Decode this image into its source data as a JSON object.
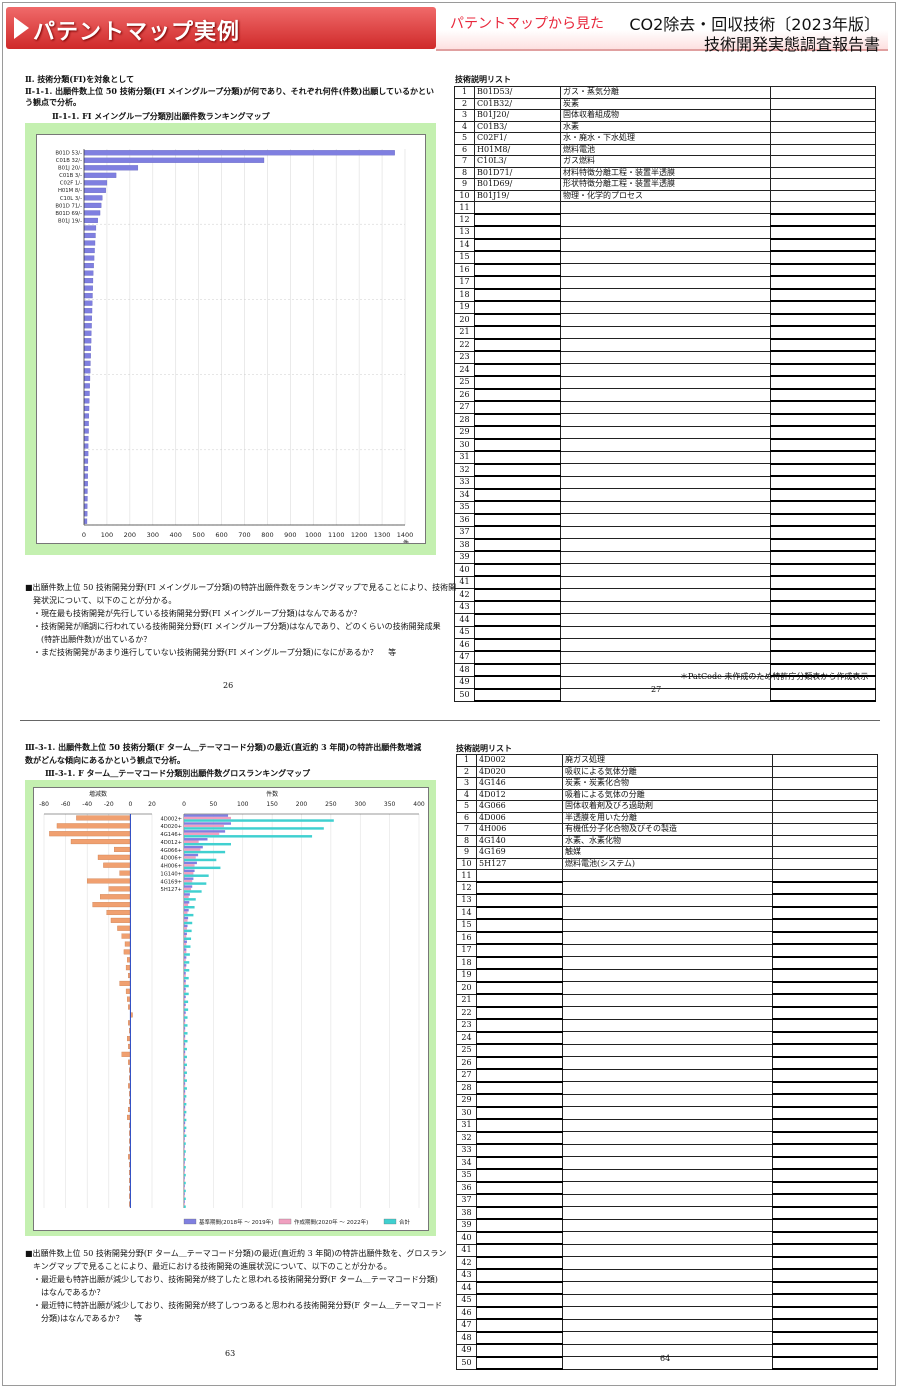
{
  "header": {
    "title": "パテントマップ実例",
    "subtitle": "パテントマップから見た",
    "report_line1": "CO2除去・回収技術〔2023年版〕",
    "report_line2": "技術開発実態調査報告書"
  },
  "sec1": {
    "heading": "Ⅱ. 技術分類(FI)を対象として",
    "sub_heading_1": "Ⅱ-1-1. 出願件数上位 50 技術分類(FI メイングループ分類)が何であり、それぞれ何件(件数)出願しているかとい",
    "sub_heading_2": "う観点で分析。",
    "chart_title": "Ⅱ-1-1. FI メイングループ分類別出願件数ランキングマップ",
    "desc": [
      "■出願件数上位 50 技術開発分野(FI メイングループ分類)の特許出願件数をランキングマップで見ることにより、技術開",
      "　発状況について、以下のことが分かる。",
      "　・現在最も技術開発が先行している技術開発分野(FI メイングループ分類)はなんであるか？",
      "　・技術開発が順調に行われている技術開発分野(FI メイングループ分類)はなんであり、どのくらいの技術開発成果",
      "　　(特許出願件数)が出ているか？",
      "　・まだ技術開発があまり進行していない技術開発分野(FI メイングループ分類)になにがあるか？　 等"
    ],
    "page_left": "26",
    "page_right": "27",
    "list_title": "技術説明リスト",
    "list_rows": [
      {
        "no": "1",
        "code": "B01D53/",
        "desc": "ガス・蒸気分離"
      },
      {
        "no": "2",
        "code": "C01B32/",
        "desc": "炭素"
      },
      {
        "no": "3",
        "code": "B01J20/",
        "desc": "固体収着組成物"
      },
      {
        "no": "4",
        "code": "C01B3/",
        "desc": "水素"
      },
      {
        "no": "5",
        "code": "C02F1/",
        "desc": "水・廃水・下水処理"
      },
      {
        "no": "6",
        "code": "H01M8/",
        "desc": "燃料電池"
      },
      {
        "no": "7",
        "code": "C10L3/",
        "desc": "ガス燃料"
      },
      {
        "no": "8",
        "code": "B01D71/",
        "desc": "材料特徴分離工程・装置半透膜"
      },
      {
        "no": "9",
        "code": "B01D69/",
        "desc": "形状特徴分離工程・装置半透膜"
      },
      {
        "no": "10",
        "code": "B01J19/",
        "desc": "物理・化学的プロセス"
      },
      {
        "no": "11",
        "code": "",
        "desc": ""
      },
      {
        "no": "12",
        "code": "",
        "desc": ""
      },
      {
        "no": "13",
        "code": "",
        "desc": ""
      },
      {
        "no": "14",
        "code": "",
        "desc": ""
      },
      {
        "no": "15",
        "code": "",
        "desc": ""
      },
      {
        "no": "16",
        "code": "",
        "desc": ""
      },
      {
        "no": "17",
        "code": "",
        "desc": ""
      },
      {
        "no": "18",
        "code": "",
        "desc": ""
      },
      {
        "no": "19",
        "code": "",
        "desc": ""
      },
      {
        "no": "20",
        "code": "",
        "desc": ""
      },
      {
        "no": "21",
        "code": "",
        "desc": ""
      },
      {
        "no": "22",
        "code": "",
        "desc": ""
      },
      {
        "no": "23",
        "code": "",
        "desc": ""
      },
      {
        "no": "24",
        "code": "",
        "desc": ""
      },
      {
        "no": "25",
        "code": "",
        "desc": ""
      },
      {
        "no": "26",
        "code": "",
        "desc": ""
      },
      {
        "no": "27",
        "code": "",
        "desc": ""
      },
      {
        "no": "28",
        "code": "",
        "desc": ""
      },
      {
        "no": "29",
        "code": "",
        "desc": ""
      },
      {
        "no": "30",
        "code": "",
        "desc": ""
      },
      {
        "no": "31",
        "code": "",
        "desc": ""
      },
      {
        "no": "32",
        "code": "",
        "desc": ""
      },
      {
        "no": "33",
        "code": "",
        "desc": ""
      },
      {
        "no": "34",
        "code": "",
        "desc": ""
      },
      {
        "no": "35",
        "code": "",
        "desc": ""
      },
      {
        "no": "36",
        "code": "",
        "desc": ""
      },
      {
        "no": "37",
        "code": "",
        "desc": ""
      },
      {
        "no": "38",
        "code": "",
        "desc": ""
      },
      {
        "no": "39",
        "code": "",
        "desc": ""
      },
      {
        "no": "40",
        "code": "",
        "desc": ""
      },
      {
        "no": "41",
        "code": "",
        "desc": ""
      },
      {
        "no": "42",
        "code": "",
        "desc": ""
      },
      {
        "no": "43",
        "code": "",
        "desc": ""
      },
      {
        "no": "44",
        "code": "",
        "desc": ""
      },
      {
        "no": "45",
        "code": "",
        "desc": ""
      },
      {
        "no": "46",
        "code": "",
        "desc": ""
      },
      {
        "no": "47",
        "code": "",
        "desc": ""
      },
      {
        "no": "48",
        "code": "",
        "desc": ""
      },
      {
        "no": "49",
        "code": "",
        "desc": ""
      },
      {
        "no": "50",
        "code": "",
        "desc": ""
      }
    ],
    "list_note": "＊PatCode 未作成のため特許庁分類表から作成表示"
  },
  "sec2": {
    "heading_1": "Ⅲ-3-1. 出願件数上位 50 技術分類(F ターム＿テーマコード分類)の最近(直近約 3 年間)の特許出願件数増減",
    "heading_2": "数がどんな傾向にあるかという観点で分析。",
    "chart_title": "Ⅲ-3-1. F ターム＿テーマコード分類別出願件数グロスランキングマップ",
    "desc": [
      "■出願件数上位 50 技術開発分野(F ターム＿テーマコード分類)の最近(直近約 3 年間)の特許出願件数を、グロスラン",
      "　キングマップで見ることにより、最近における技術開発の進展状況について、以下のことが分かる。",
      "　・最近最も特許出願が減少しており、技術開発が終了したと思われる技術開発分野(F ターム＿テーマコード分類)",
      "　　はなんであるか？",
      "　・最近特に特許出願が減少しており、技術開発が終了しつつあると思われる技術開発分野(F ターム＿テーマコード",
      "　　分類)はなんであるか？　 等"
    ],
    "page_left": "63",
    "page_right": "64",
    "list_title": "技術説明リスト",
    "list_rows": [
      {
        "no": "1",
        "code": "4D002",
        "desc": "廃ガス処理"
      },
      {
        "no": "2",
        "code": "4D020",
        "desc": "吸収による気体分離"
      },
      {
        "no": "3",
        "code": "4G146",
        "desc": "炭素・炭素化合物"
      },
      {
        "no": "4",
        "code": "4D012",
        "desc": "吸着による気体の分離"
      },
      {
        "no": "5",
        "code": "4G066",
        "desc": "固体収着剤及びろ過助剤"
      },
      {
        "no": "6",
        "code": "4D006",
        "desc": "半透膜を用いた分離"
      },
      {
        "no": "7",
        "code": "4H006",
        "desc": "有機低分子化合物及びその製造"
      },
      {
        "no": "8",
        "code": "4G140",
        "desc": "水素、水素化物"
      },
      {
        "no": "9",
        "code": "4G169",
        "desc": "触媒"
      },
      {
        "no": "10",
        "code": "5H127",
        "desc": "燃料電池(システム)"
      },
      {
        "no": "11",
        "code": "",
        "desc": ""
      },
      {
        "no": "12",
        "code": "",
        "desc": ""
      },
      {
        "no": "13",
        "code": "",
        "desc": ""
      },
      {
        "no": "14",
        "code": "",
        "desc": ""
      },
      {
        "no": "15",
        "code": "",
        "desc": ""
      },
      {
        "no": "16",
        "code": "",
        "desc": ""
      },
      {
        "no": "17",
        "code": "",
        "desc": ""
      },
      {
        "no": "18",
        "code": "",
        "desc": ""
      },
      {
        "no": "19",
        "code": "",
        "desc": ""
      },
      {
        "no": "20",
        "code": "",
        "desc": ""
      },
      {
        "no": "21",
        "code": "",
        "desc": ""
      },
      {
        "no": "22",
        "code": "",
        "desc": ""
      },
      {
        "no": "23",
        "code": "",
        "desc": ""
      },
      {
        "no": "24",
        "code": "",
        "desc": ""
      },
      {
        "no": "25",
        "code": "",
        "desc": ""
      },
      {
        "no": "26",
        "code": "",
        "desc": ""
      },
      {
        "no": "27",
        "code": "",
        "desc": ""
      },
      {
        "no": "28",
        "code": "",
        "desc": ""
      },
      {
        "no": "29",
        "code": "",
        "desc": ""
      },
      {
        "no": "30",
        "code": "",
        "desc": ""
      },
      {
        "no": "31",
        "code": "",
        "desc": ""
      },
      {
        "no": "32",
        "code": "",
        "desc": ""
      },
      {
        "no": "33",
        "code": "",
        "desc": ""
      },
      {
        "no": "34",
        "code": "",
        "desc": ""
      },
      {
        "no": "35",
        "code": "",
        "desc": ""
      },
      {
        "no": "36",
        "code": "",
        "desc": ""
      },
      {
        "no": "37",
        "code": "",
        "desc": ""
      },
      {
        "no": "38",
        "code": "",
        "desc": ""
      },
      {
        "no": "39",
        "code": "",
        "desc": ""
      },
      {
        "no": "40",
        "code": "",
        "desc": ""
      },
      {
        "no": "41",
        "code": "",
        "desc": ""
      },
      {
        "no": "42",
        "code": "",
        "desc": ""
      },
      {
        "no": "43",
        "code": "",
        "desc": ""
      },
      {
        "no": "44",
        "code": "",
        "desc": ""
      },
      {
        "no": "45",
        "code": "",
        "desc": ""
      },
      {
        "no": "46",
        "code": "",
        "desc": ""
      },
      {
        "no": "47",
        "code": "",
        "desc": ""
      },
      {
        "no": "48",
        "code": "",
        "desc": ""
      },
      {
        "no": "49",
        "code": "",
        "desc": ""
      },
      {
        "no": "50",
        "code": "",
        "desc": ""
      }
    ]
  },
  "chart_data": [
    {
      "type": "bar",
      "orientation": "horizontal",
      "categories": [
        "B01D 53/-",
        "C01B 32/-",
        "B01J 20/-",
        "C01B 3/-",
        "C02F 1/-",
        "H01M 8/-",
        "C10L 3/-",
        "B01D 71/-",
        "B01D 69/-",
        "B01J 19/-"
      ],
      "values": [
        1355,
        785,
        235,
        140,
        100,
        95,
        80,
        75,
        70,
        60,
        52,
        50,
        48,
        46,
        44,
        42,
        40,
        39,
        38,
        37,
        36,
        35,
        34,
        33,
        32,
        31,
        30,
        29,
        28,
        27,
        26,
        25,
        24,
        23,
        22,
        21,
        20,
        20,
        19,
        18,
        18,
        17,
        17,
        16,
        16,
        15,
        15,
        14,
        14,
        13
      ],
      "xlim": [
        0,
        1400
      ],
      "xticks": [
        "0",
        "100",
        "200",
        "300",
        "400",
        "500",
        "600",
        "700",
        "800",
        "900",
        "1000",
        "1100",
        "1200",
        "1300",
        "1400"
      ],
      "unit": "件",
      "bar_color": "#7f7fe0",
      "grid": true
    },
    {
      "type": "bar",
      "orientation": "horizontal",
      "subtype": "diverging",
      "title": "増減数",
      "xlim": [
        -80,
        20
      ],
      "xticks": [
        "-80",
        "-60",
        "-40",
        "-20",
        "0",
        "20"
      ],
      "values": [
        -50,
        -68,
        -75,
        -55,
        -15,
        -30,
        -25,
        -10,
        -40,
        -20,
        -28,
        -35,
        -22,
        -18,
        -12,
        -8,
        -5,
        -6,
        -3,
        -4,
        -2,
        -10,
        -4,
        -3,
        -2,
        2,
        -2,
        -1,
        -3,
        -2,
        -8,
        -2,
        -1,
        -1,
        -2,
        -1,
        -1,
        -2,
        -3,
        -1,
        -1,
        -1,
        -1,
        -2,
        -1,
        -1,
        -1,
        -1,
        -1,
        -1
      ],
      "color": "#f0a070"
    },
    {
      "type": "bar",
      "orientation": "horizontal",
      "subtype": "stacked",
      "title": "件数",
      "categories": [
        "4D002+",
        "4D020+",
        "4G146+",
        "4D012+",
        "4G066+",
        "4D006+",
        "4H006+",
        "1G140+",
        "4G169+",
        "5H127+"
      ],
      "xlim": [
        0,
        400
      ],
      "xticks": [
        "0",
        "50",
        "100",
        "150",
        "200",
        "250",
        "300",
        "350",
        "400"
      ],
      "series": [
        {
          "name": "基準期間(2018年 ～ 2019年)",
          "color": "#8080e0",
          "values": [
            75,
            80,
            70,
            40,
            32,
            24,
            22,
            18,
            16,
            14,
            10,
            9,
            8,
            7,
            6,
            5,
            5,
            4,
            4,
            4,
            3,
            3,
            3,
            3,
            3,
            3,
            2,
            2,
            2,
            2,
            2,
            2,
            2,
            2,
            2,
            2,
            2,
            2,
            2,
            2,
            2,
            1,
            1,
            1,
            1,
            1,
            1,
            1,
            1,
            1
          ]
        },
        {
          "name": "作成期間(2020年 ～ 2022年)",
          "color": "#f0a0c0",
          "values": [
            80,
            68,
            60,
            25,
            28,
            20,
            18,
            16,
            14,
            12,
            8,
            7,
            6,
            6,
            5,
            4,
            4,
            4,
            3,
            3,
            3,
            3,
            3,
            2,
            2,
            2,
            2,
            2,
            2,
            2,
            2,
            2,
            2,
            2,
            2,
            2,
            2,
            2,
            1,
            1,
            1,
            1,
            1,
            1,
            1,
            1,
            1,
            1,
            1,
            1
          ]
        },
        {
          "name": "合計",
          "color": "#40d0d0",
          "values": [
            255,
            238,
            218,
            80,
            70,
            55,
            62,
            42,
            38,
            30,
            20,
            18,
            16,
            14,
            13,
            12,
            11,
            10,
            9,
            9,
            8,
            8,
            8,
            7,
            7,
            6,
            6,
            6,
            6,
            5,
            5,
            5,
            5,
            5,
            5,
            4,
            4,
            4,
            4,
            4,
            4,
            3,
            3,
            3,
            3,
            3,
            3,
            3,
            3,
            3
          ]
        }
      ]
    }
  ]
}
